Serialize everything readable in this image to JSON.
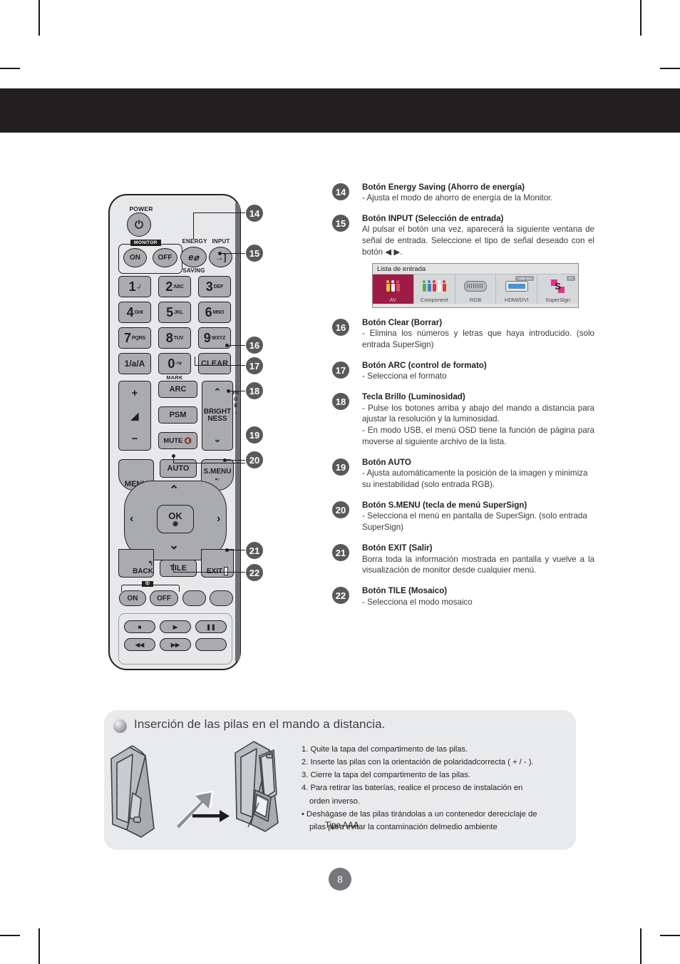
{
  "page": {
    "number": "8"
  },
  "descriptions": [
    {
      "badge": "14",
      "title": "Botón Energy Saving (Ahorro de energía)",
      "body": "- Ajusta el modo de ahorro de energía de la Monitor."
    },
    {
      "badge": "15",
      "title": "Botón INPUT (Selección de entrada)",
      "body": "Al pulsar el botón una vez, aparecerá la siguiente ventana de señal de entrada. Seleccione el tipo de señal deseado con el botón ◀ ▶."
    },
    {
      "badge": "16",
      "title": "Botón Clear (Borrar)",
      "body": "- Elimina los números y letras que haya introducido. (solo entrada SuperSign)"
    },
    {
      "badge": "17",
      "title": "Botón ARC (control de formato)",
      "body": "- Selecciona el formato"
    },
    {
      "badge": "18",
      "title": "Tecla Brillo (Luminosidad)",
      "body": "- Pulse los botones arriba y abajo del mando a distancia para ajustar la resolución y la luminosidad.",
      "body2": "- En modo USB, el menú OSD tiene la función de página para moverse al siguiente archivo de la lista."
    },
    {
      "badge": "19",
      "title": "Botón AUTO",
      "body": "- Ajusta automáticamente la posición de la imagen y minimiza su inestabilidad (solo entrada RGB)."
    },
    {
      "badge": "20",
      "title": "Botón S.MENU (tecla de menú SuperSign)",
      "body": "- Selecciona el menú en pantalla de SuperSign. (solo entrada SuperSign)"
    },
    {
      "badge": "21",
      "title": "Botón EXIT (Salir)",
      "body": "Borra toda la información mostrada en pantalla y vuelve a la visualización de monitor desde cualquier menú."
    },
    {
      "badge": "22",
      "title": "Botón TILE (Mosaico)",
      "body": "- Selecciona el modo mosaico"
    }
  ],
  "osd": {
    "title": "Lista de entrada",
    "items": [
      {
        "label": "AV",
        "icon": "rca-av-icon",
        "selected": true,
        "tag": ""
      },
      {
        "label": "Component",
        "icon": "rca-component-icon",
        "selected": false,
        "tag": ""
      },
      {
        "label": "RGB",
        "icon": "dsub-connector-icon",
        "selected": false,
        "tag": ""
      },
      {
        "label": "HDMI/DVI",
        "icon": "hdmi-connector-icon",
        "selected": false,
        "tag": "Cable Box"
      },
      {
        "label": "SuperSign",
        "icon": "supersign-logo-icon",
        "selected": false,
        "tag": "PC"
      }
    ]
  },
  "remote": {
    "callouts": [
      "14",
      "15",
      "16",
      "17",
      "18",
      "19",
      "20",
      "21",
      "22"
    ],
    "labels": {
      "power": "POWER",
      "monitor": "MONITOR",
      "on": "ON",
      "off": "OFF",
      "energy": "ENERGY",
      "saving": "SAVING",
      "input": "INPUT",
      "mark": "MARK",
      "clear": "CLEAR",
      "alpha": "1/a/A",
      "arc": "ARC",
      "psm": "PSM",
      "mute": "MUTE",
      "brightness_1": "BRIGHT",
      "brightness_2": "NESS",
      "page": "PAGE",
      "menu": "MENU",
      "auto": "AUTO",
      "smenu": "S.MENU",
      "ok": "OK",
      "back": "BACK",
      "tile": "TILE",
      "exit": "EXIT",
      "id": "ID"
    },
    "keys": [
      {
        "num": "1",
        "sub": ".,!"
      },
      {
        "num": "2",
        "sub": "ABC"
      },
      {
        "num": "3",
        "sub": "DEF"
      },
      {
        "num": "4",
        "sub": "GHI"
      },
      {
        "num": "5",
        "sub": "JKL"
      },
      {
        "num": "6",
        "sub": "MNO"
      },
      {
        "num": "7",
        "sub": "PQRS"
      },
      {
        "num": "8",
        "sub": "TUV"
      },
      {
        "num": "9",
        "sub": "WXYZ"
      },
      {
        "num": "0",
        "sub": "-*#"
      }
    ]
  },
  "battery": {
    "heading": "Inserción de las pilas en el mando a distancia.",
    "type_label": "Tipo AAA",
    "steps": [
      "1. Quite la tapa del compartimento de las pilas.",
      "2. Inserte las pilas con la orientación de polaridadcorrecta ( + / - ).",
      "3. Cierre la tapa del compartimento de las pilas.",
      "4. Para retirar las baterías, realice el proceso de instalación en",
      "orden inverso.",
      "• Deshágase de las pilas tirándolas a un contenedor dereciclaje de",
      "pilas para evitar la contaminación delmedio ambiente"
    ]
  },
  "colors": {
    "header_band": "#231f20",
    "badge": "#58595b",
    "osd_selected": "#9e1b46",
    "panel_bg": "#e9eaec",
    "remote_body": "#e7e8ea",
    "button": "#a9abae"
  }
}
